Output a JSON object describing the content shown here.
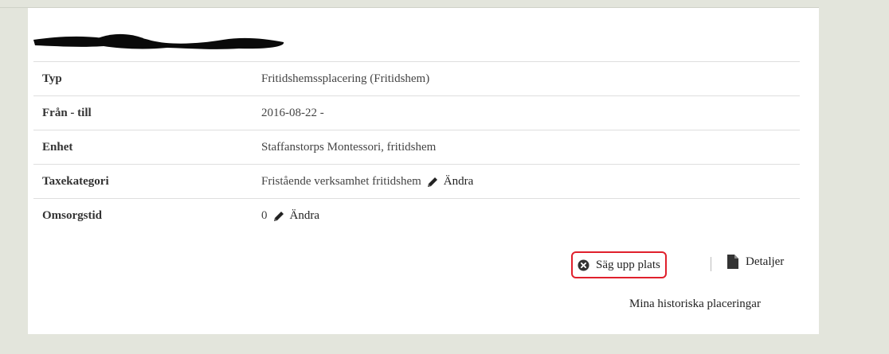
{
  "placement": {
    "rows": [
      {
        "label": "Typ",
        "value": "Fritidshemssplacering  (Fritidshem)"
      },
      {
        "label": "Från - till",
        "value": "2016-08-22 -"
      },
      {
        "label": "Enhet",
        "value": "Staffanstorps Montessori, fritidshem"
      },
      {
        "label": "Taxekategori",
        "value": "Fristående verksamhet fritidshem",
        "edit_label": "Ändra"
      },
      {
        "label": "Omsorgstid",
        "value": "0",
        "edit_label": "Ändra"
      }
    ]
  },
  "actions": {
    "cancel_label": "Säg upp plats",
    "details_label": "Detaljer",
    "history_label": "Mina historiska placeringar"
  },
  "icons": {
    "edit": "pencil-icon",
    "cancel": "circle-x-icon",
    "details": "document-icon"
  },
  "colors": {
    "background": "#e3e5dc",
    "card": "#ffffff",
    "highlight": "#e0202c"
  }
}
